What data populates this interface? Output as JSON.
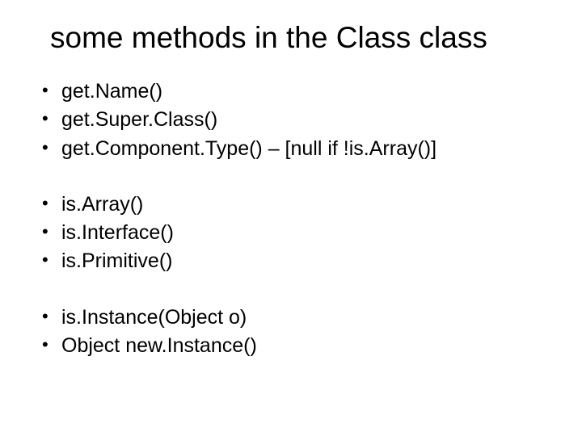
{
  "title": "some methods in the Class class",
  "groups": [
    {
      "items": [
        "get.Name()",
        "get.Super.Class()",
        "get.Component.Type() – [null if !is.Array()]"
      ]
    },
    {
      "items": [
        "is.Array()",
        "is.Interface()",
        "is.Primitive()"
      ]
    },
    {
      "items": [
        "is.Instance(Object o)",
        "Object new.Instance()"
      ]
    }
  ]
}
